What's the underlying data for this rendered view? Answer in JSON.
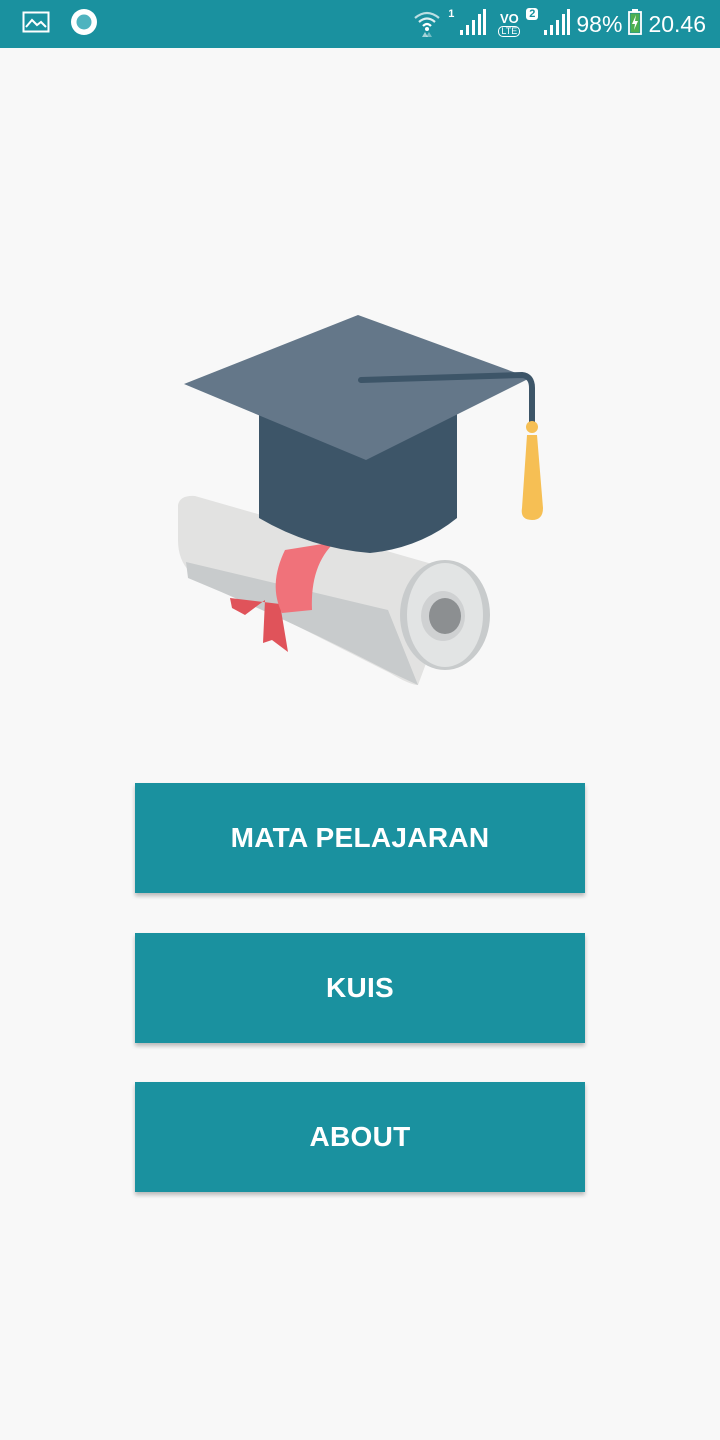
{
  "theme": {
    "accent": "#1a919f"
  },
  "status_bar": {
    "left_icons": [
      "gallery-icon",
      "record-icon"
    ],
    "sim1_label": "1",
    "volte_top": "VO",
    "volte_bottom": "LTE",
    "sim2_label": "2",
    "battery_percent": "98%",
    "time": "20.46"
  },
  "main": {
    "illustration": "graduation-cap-and-diploma",
    "buttons": [
      {
        "label": "MATA PELAJARAN"
      },
      {
        "label": "KUIS"
      },
      {
        "label": "ABOUT"
      }
    ]
  }
}
